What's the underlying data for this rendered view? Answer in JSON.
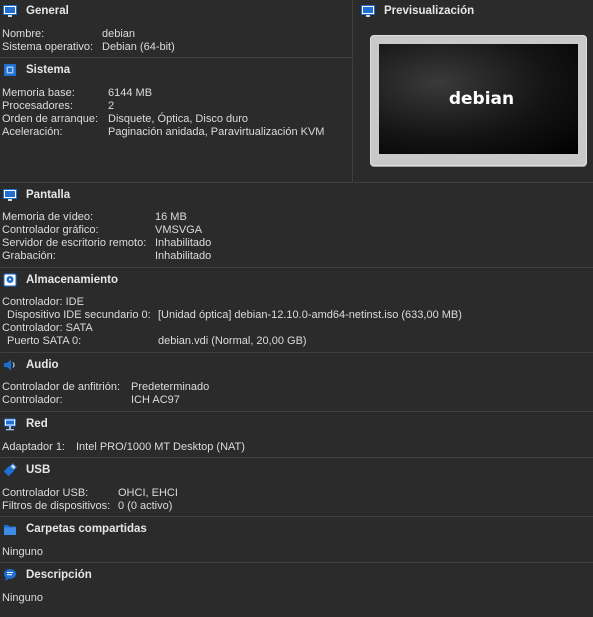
{
  "general": {
    "title": "General",
    "rows": [
      {
        "label": "Nombre:",
        "value": "debian"
      },
      {
        "label": "Sistema operativo:",
        "value": "Debian (64-bit)"
      }
    ]
  },
  "preview": {
    "title": "Previsualización",
    "screen_text": "debian"
  },
  "sistema": {
    "title": "Sistema",
    "rows": [
      {
        "label": "Memoria base:",
        "value": "6144 MB"
      },
      {
        "label": "Procesadores:",
        "value": "2"
      },
      {
        "label": "Orden de arranque:",
        "value": "Disquete, Óptica, Disco duro"
      },
      {
        "label": "Aceleración:",
        "value": "Paginación anidada, Paravirtualización KVM"
      }
    ]
  },
  "pantalla": {
    "title": "Pantalla",
    "rows": [
      {
        "label": "Memoria de vídeo:",
        "value": "16 MB"
      },
      {
        "label": "Controlador gráfico:",
        "value": "VMSVGA"
      },
      {
        "label": "Servidor de escritorio remoto:",
        "value": "Inhabilitado"
      },
      {
        "label": "Grabación:",
        "value": "Inhabilitado"
      }
    ]
  },
  "almacenamiento": {
    "title": "Almacenamiento",
    "rows": [
      {
        "label": "Controlador: IDE",
        "value": ""
      },
      {
        "label": "  Dispositivo IDE secundario 0:",
        "value": "[Unidad óptica] debian-12.10.0-amd64-netinst.iso (633,00 MB)"
      },
      {
        "label": "Controlador: SATA",
        "value": ""
      },
      {
        "label": "  Puerto SATA 0:",
        "value": "debian.vdi (Normal, 20,00 GB)"
      }
    ]
  },
  "audio": {
    "title": "Audio",
    "rows": [
      {
        "label": "Controlador de anfitrión:",
        "value": "Predeterminado"
      },
      {
        "label": "Controlador:",
        "value": "ICH AC97"
      }
    ]
  },
  "red": {
    "title": "Red",
    "rows": [
      {
        "label": "Adaptador 1:",
        "value": "Intel PRO/1000 MT Desktop (NAT)"
      }
    ]
  },
  "usb": {
    "title": "USB",
    "rows": [
      {
        "label": "Controlador USB:",
        "value": "OHCI, EHCI"
      },
      {
        "label": "Filtros de dispositivos:",
        "value": "0 (0 activo)"
      }
    ]
  },
  "carpetas": {
    "title": "Carpetas compartidas",
    "rows": [
      {
        "label": "Ninguno",
        "value": ""
      }
    ]
  },
  "descripcion": {
    "title": "Descripción",
    "rows": [
      {
        "label": "Ninguno",
        "value": ""
      }
    ]
  },
  "colors": {
    "background": "#2b2b2b",
    "icon_blue": "#1e6fd0",
    "text": "#dcdcdc"
  }
}
